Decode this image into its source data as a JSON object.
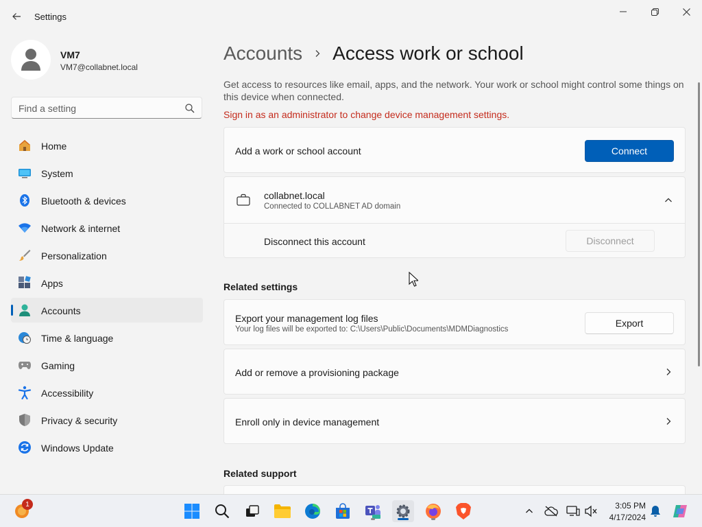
{
  "window": {
    "title": "Settings"
  },
  "profile": {
    "name": "VM7",
    "email": "VM7@collabnet.local"
  },
  "search": {
    "placeholder": "Find a setting"
  },
  "sidebar": {
    "items": [
      {
        "label": "Home",
        "icon": "home-icon"
      },
      {
        "label": "System",
        "icon": "system-icon"
      },
      {
        "label": "Bluetooth & devices",
        "icon": "bluetooth-icon"
      },
      {
        "label": "Network & internet",
        "icon": "wifi-icon"
      },
      {
        "label": "Personalization",
        "icon": "brush-icon"
      },
      {
        "label": "Apps",
        "icon": "apps-icon"
      },
      {
        "label": "Accounts",
        "icon": "accounts-icon",
        "active": true
      },
      {
        "label": "Time & language",
        "icon": "globe-clock-icon"
      },
      {
        "label": "Gaming",
        "icon": "gamepad-icon"
      },
      {
        "label": "Accessibility",
        "icon": "accessibility-icon"
      },
      {
        "label": "Privacy & security",
        "icon": "shield-icon"
      },
      {
        "label": "Windows Update",
        "icon": "update-icon"
      }
    ]
  },
  "header": {
    "parent": "Accounts",
    "current": "Access work or school"
  },
  "main": {
    "description": "Get access to resources like email, apps, and the network. Your work or school might control some things on this device when connected.",
    "admin_warning": "Sign in as an administrator to change device management settings.",
    "add_account": {
      "label": "Add a work or school account",
      "button": "Connect"
    },
    "account": {
      "name": "collabnet.local",
      "status": "Connected to COLLABNET AD domain",
      "disconnect_label": "Disconnect this account",
      "disconnect_button": "Disconnect"
    },
    "related_settings": {
      "heading": "Related settings",
      "export": {
        "title": "Export your management log files",
        "subtitle": "Your log files will be exported to: C:\\Users\\Public\\Documents\\MDMDiagnostics",
        "button": "Export"
      },
      "provisioning": "Add or remove a provisioning package",
      "enroll": "Enroll only in device management"
    },
    "related_support": {
      "heading": "Related support"
    }
  },
  "taskbar": {
    "weather_badge": "1",
    "clock": {
      "time": "3:05 PM",
      "date": "4/17/2024"
    },
    "apps": [
      "start",
      "search",
      "task-view",
      "file-explorer",
      "edge",
      "store",
      "teams",
      "settings",
      "firefox",
      "brave"
    ]
  },
  "colors": {
    "accent": "#005fb8",
    "warning": "#c42b1c",
    "background": "#f3f3f3",
    "card": "#fbfbfb"
  }
}
